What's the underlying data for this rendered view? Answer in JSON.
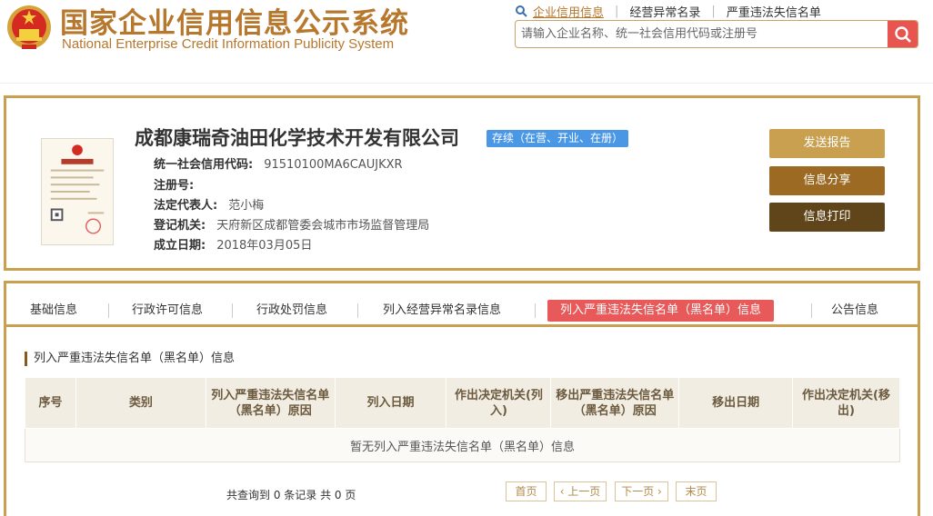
{
  "header": {
    "title_cn": "国家企业信用信息公示系统",
    "title_en": "National Enterprise Credit Information Publicity System",
    "nav": [
      "企业信用信息",
      "经营异常名录",
      "严重违法失信名单"
    ],
    "search_placeholder": "请输入企业名称、统一社会信用代码或注册号",
    "accent_color": "#b7772c",
    "search_button_color": "#e8544f"
  },
  "company": {
    "name": "成都康瑞奇油田化学技术开发有限公司",
    "status": "存续（在营、开业、在册）",
    "fields": [
      {
        "label": "统一社会信用代码:",
        "value": "91510100MA6CAUJKXR"
      },
      {
        "label": "注册号:",
        "value": ""
      },
      {
        "label": "法定代表人:",
        "value": "范小梅"
      },
      {
        "label": "登记机关:",
        "value": "天府新区成都管委会城市市场监督管理局"
      },
      {
        "label": "成立日期:",
        "value": "2018年03月05日"
      }
    ],
    "license_icon": "business-license-icon"
  },
  "actions": {
    "report": "发送报告",
    "share": "信息分享",
    "print": "信息打印"
  },
  "tabs": [
    "基础信息",
    "行政许可信息",
    "行政处罚信息",
    "列入经营异常名录信息",
    "列入严重违法失信名单（黑名单）信息",
    "公告信息"
  ],
  "active_tab": 4,
  "section": {
    "title": "列入严重违法失信名单（黑名单）信息",
    "columns": [
      "序号",
      "类别",
      "列入严重违法失信名单（黑名单）原因",
      "列入日期",
      "作出决定机关(列入)",
      "移出严重违法失信名单（黑名单）原因",
      "移出日期",
      "作出决定机关(移出)"
    ],
    "empty_text": "暂无列入严重违法失信名单（黑名单）信息"
  },
  "pagination": {
    "summary": "共查询到 0 条记录 共 0 页",
    "first": "首页",
    "prev": "‹ 上一页",
    "next": "下一页 ›",
    "last": "末页"
  }
}
